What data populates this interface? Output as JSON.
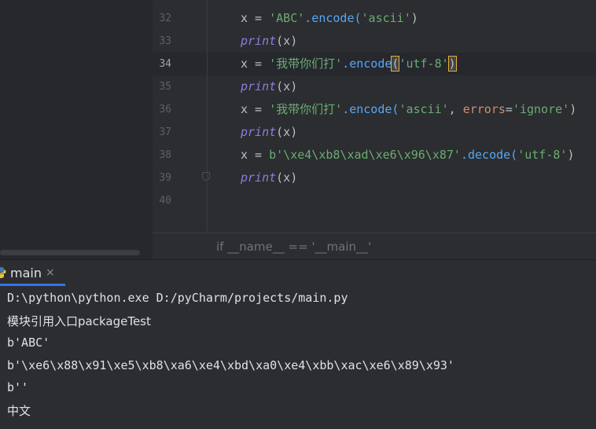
{
  "editor": {
    "lines": [
      {
        "num": "32",
        "tokens": [
          [
            "x = ",
            "plain"
          ],
          [
            "'ABC'",
            "str"
          ],
          [
            ".encode(",
            "fn"
          ],
          [
            "'ascii'",
            "str"
          ],
          [
            ")",
            "plain"
          ]
        ]
      },
      {
        "num": "33",
        "tokens": [
          [
            "print",
            "italic"
          ],
          [
            "(x)",
            "plain"
          ]
        ]
      },
      {
        "num": "34",
        "tokens": [
          [
            "x = ",
            "plain"
          ],
          [
            "'我带你们打'",
            "str"
          ],
          [
            ".encode",
            "fn"
          ],
          [
            "(",
            "hl"
          ],
          [
            "'utf-8'",
            "str"
          ],
          [
            ")",
            "hl"
          ]
        ]
      },
      {
        "num": "35",
        "tokens": [
          [
            "print",
            "italic"
          ],
          [
            "(x)",
            "plain"
          ]
        ]
      },
      {
        "num": "36",
        "tokens": [
          [
            "x = ",
            "plain"
          ],
          [
            "'我带你们打'",
            "str"
          ],
          [
            ".encode(",
            "fn"
          ],
          [
            "'ascii'",
            "str"
          ],
          [
            ", ",
            "plain"
          ],
          [
            "errors",
            "param"
          ],
          [
            "=",
            "plain"
          ],
          [
            "'ignore'",
            "str"
          ],
          [
            ")",
            "plain"
          ]
        ]
      },
      {
        "num": "37",
        "tokens": [
          [
            "print",
            "italic"
          ],
          [
            "(x)",
            "plain"
          ]
        ]
      },
      {
        "num": "38",
        "tokens": [
          [
            "x = ",
            "plain"
          ],
          [
            "b'\\xe4\\xb8\\xad\\xe6\\x96\\x87'",
            "str"
          ],
          [
            ".decode(",
            "fn"
          ],
          [
            "'utf-8'",
            "str"
          ],
          [
            ")",
            "plain"
          ]
        ]
      },
      {
        "num": "39",
        "tokens": [
          [
            "print",
            "italic"
          ],
          [
            "(x)",
            "plain"
          ]
        ]
      },
      {
        "num": "40",
        "tokens": []
      }
    ],
    "breadcrumb": "if __name__ == '__main__'"
  },
  "run_panel": {
    "tab_label": "main",
    "tab_close": "×",
    "tab_icon": "python-icon",
    "output": [
      "D:\\python\\python.exe D:/pyCharm/projects/main.py",
      "模块引用入口packageTest",
      "b'ABC'",
      "b'\\xe6\\x88\\x91\\xe5\\xb8\\xa6\\xe4\\xbd\\xa0\\xe4\\xbb\\xac\\xe6\\x89\\x93'",
      "b''",
      "中文"
    ]
  },
  "colors": {
    "string": "#6aab73",
    "function": "#56a8f5",
    "builtin_italic": "#8a7fdf",
    "keyword_param": "#cf8e6d",
    "tab_underline": "#3574f0"
  }
}
